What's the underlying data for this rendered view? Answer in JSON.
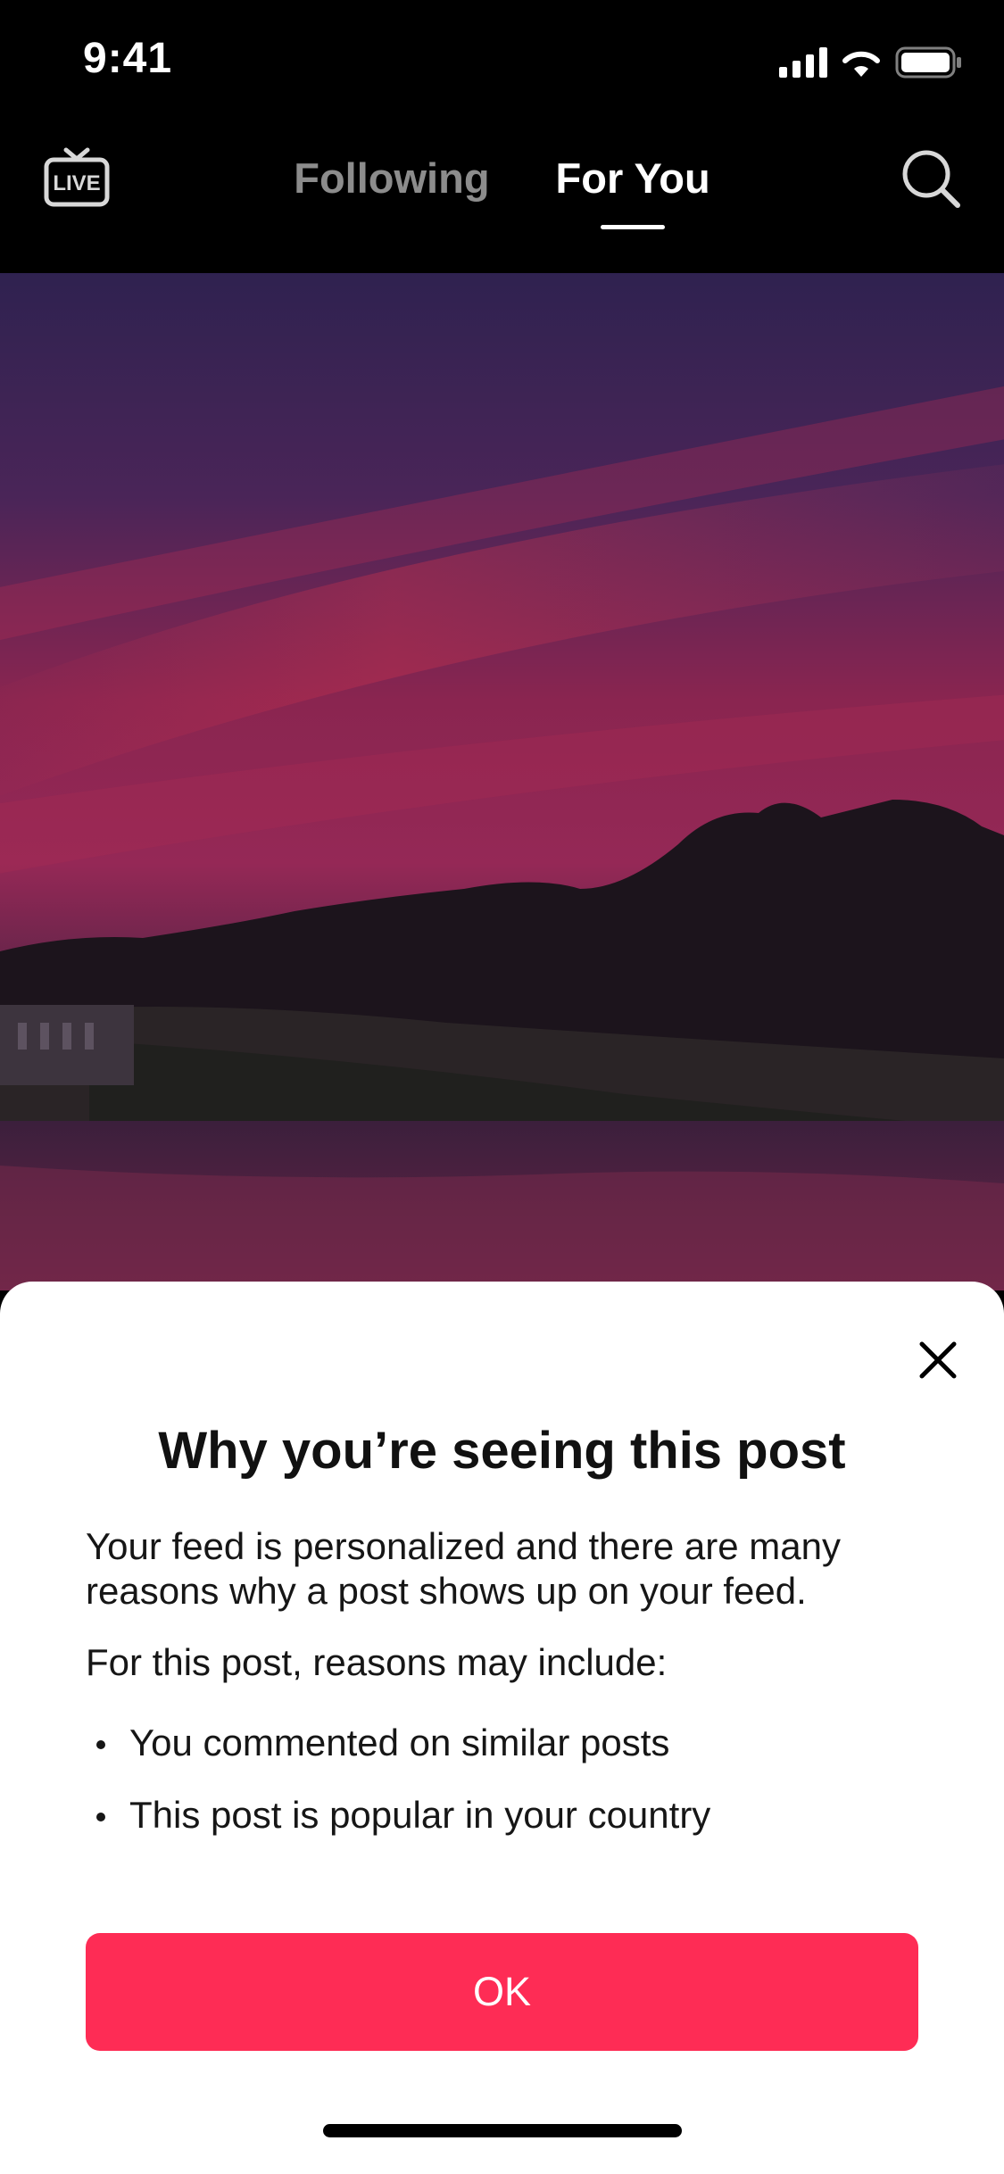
{
  "status_bar": {
    "time": "9:41"
  },
  "top_nav": {
    "live_label": "LIVE",
    "tabs": [
      {
        "label": "Following",
        "active": false
      },
      {
        "label": "For You",
        "active": true
      }
    ],
    "search_icon": "search-icon"
  },
  "video": {
    "creator_avatar": "avatar",
    "follow_icon": "plus-icon"
  },
  "sheet": {
    "title": "Why you’re seeing this post",
    "intro": "Your feed is personalized and there are many reasons why a post shows up on your feed.",
    "reasons_heading": "For this post, reasons may include:",
    "reasons": [
      "You commented on similar posts",
      "This post is popular in your country"
    ],
    "ok_label": "OK",
    "close_icon": "close-icon"
  },
  "colors": {
    "accent": "#fe2c55",
    "follow_plus": "#9e1a3c",
    "background": "#000000",
    "sheet": "#ffffff"
  }
}
